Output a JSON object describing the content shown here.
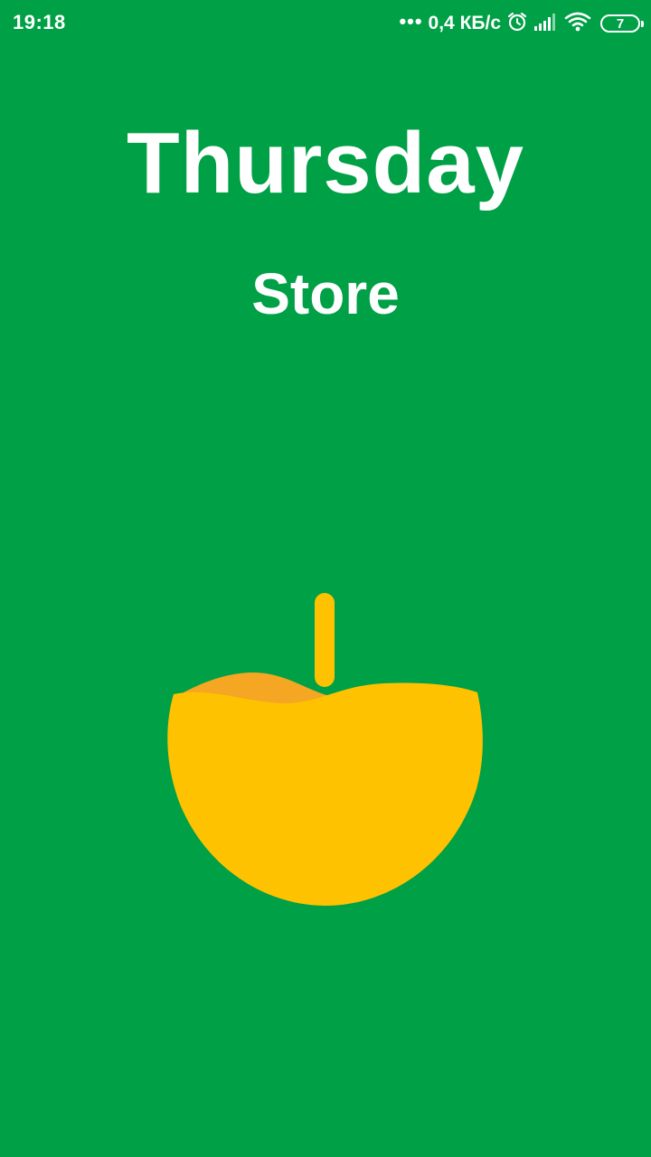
{
  "status_bar": {
    "time": "19:18",
    "net_dots": "•••",
    "net_speed": "0,4 КБ/с",
    "icons": [
      "alarm-icon",
      "signal-icon",
      "wifi-icon",
      "battery-icon"
    ],
    "battery_level": "7"
  },
  "splash": {
    "title": "Thursday",
    "subtitle": "Store",
    "logo_icon": "apple-bowl-logo"
  },
  "colors": {
    "background": "#00A046",
    "logo_yellow": "#FFC200",
    "logo_orange": "#F5A623",
    "text": "#FFFFFF"
  }
}
